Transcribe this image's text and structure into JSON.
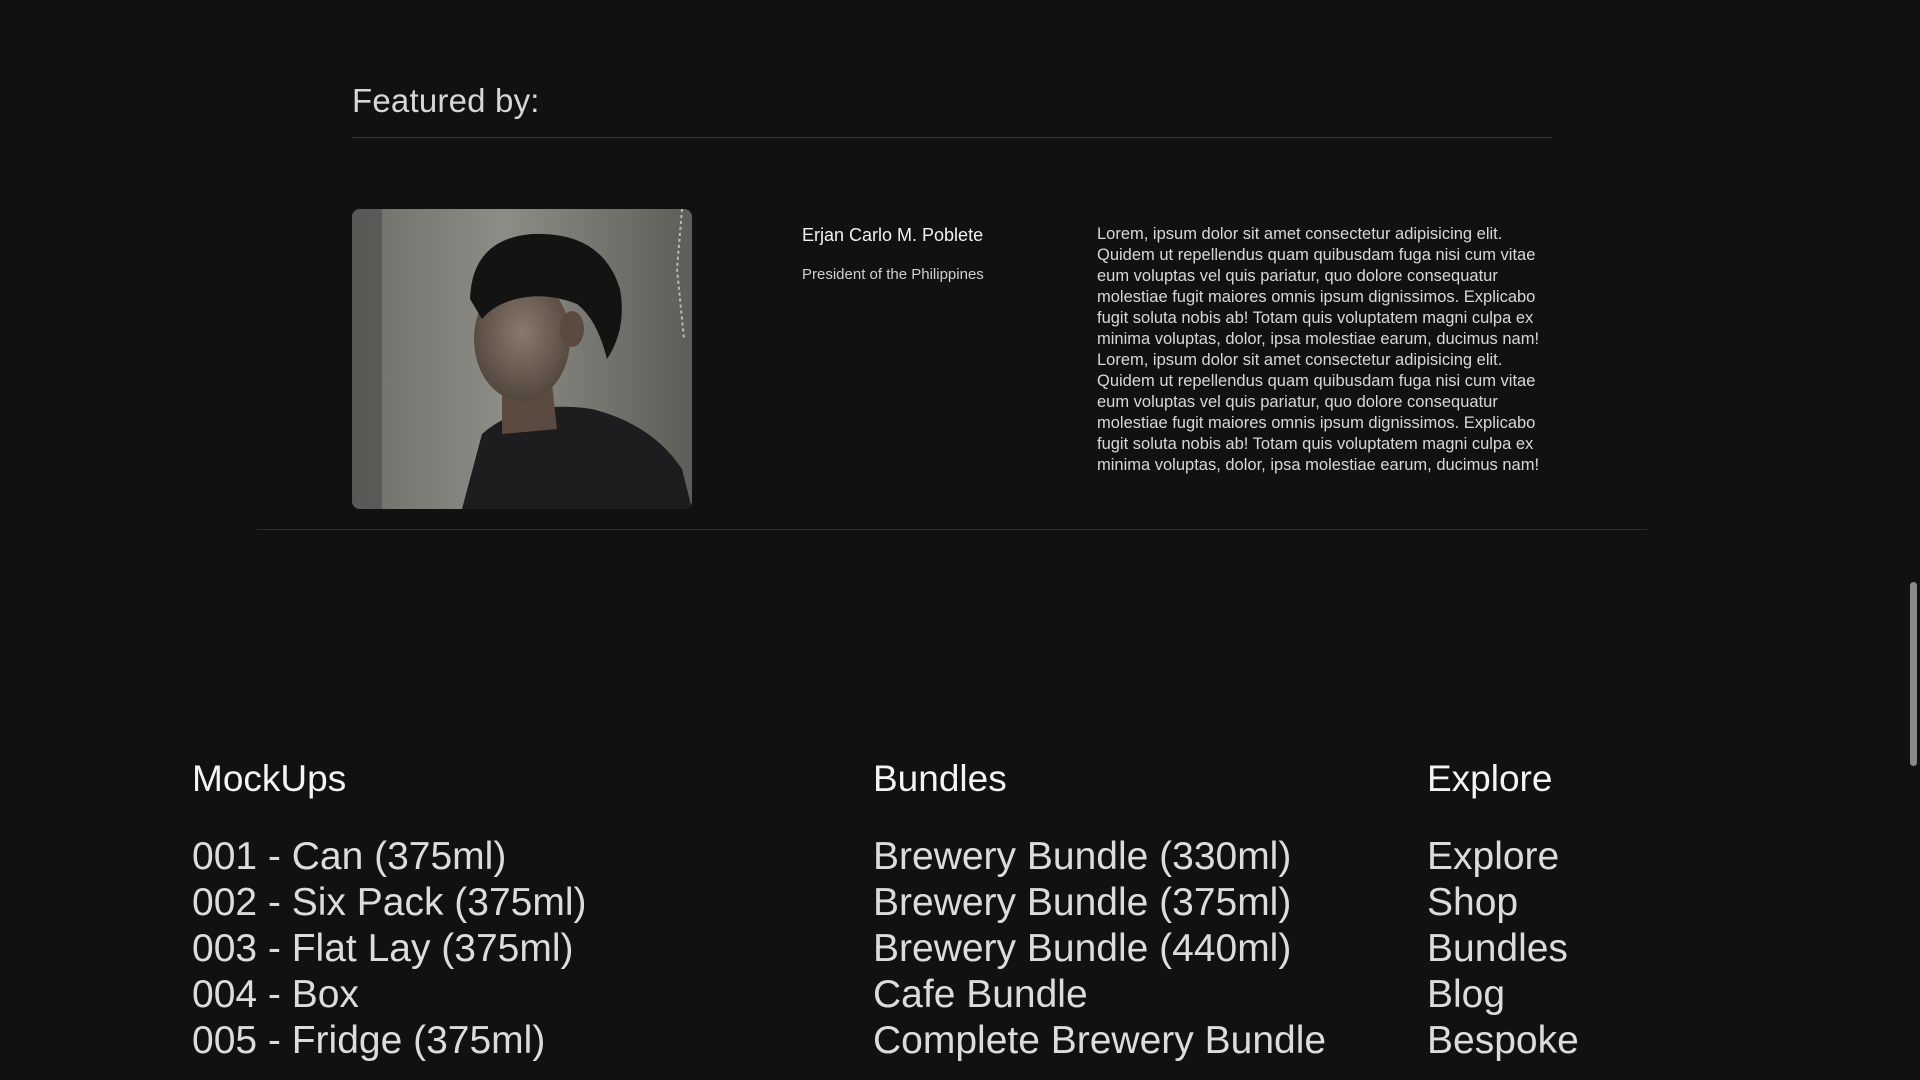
{
  "featured": {
    "heading": "Featured by:",
    "person": {
      "name": "Erjan Carlo M. Poblete",
      "title": "President of the Philippines",
      "bio": "Lorem, ipsum dolor sit amet consectetur adipisicing elit. Quidem ut repellendus quam quibusdam fuga nisi cum vitae eum voluptas vel quis pariatur, quo dolore consequatur molestiae fugit maiores omnis ipsum dignissimos. Explicabo fugit soluta nobis ab! Totam quis voluptatem magni culpa ex minima voluptas, dolor, ipsa molestiae earum, ducimus nam! Lorem, ipsum dolor sit amet consectetur adipisicing elit. Quidem ut repellendus quam quibusdam fuga nisi cum vitae eum voluptas vel quis pariatur, quo dolore consequatur molestiae fugit maiores omnis ipsum dignissimos. Explicabo fugit soluta nobis ab! Totam quis voluptatem magni culpa ex minima voluptas, dolor, ipsa molestiae earum, ducimus nam!"
    }
  },
  "footer": {
    "mockups": {
      "heading": "MockUps",
      "items": [
        "001 - Can (375ml)",
        "002 - Six Pack (375ml)",
        "003 - Flat Lay (375ml)",
        "004 - Box",
        "005 - Fridge (375ml)"
      ]
    },
    "bundles": {
      "heading": "Bundles",
      "items": [
        "Brewery Bundle (330ml)",
        "Brewery Bundle (375ml)",
        "Brewery Bundle (440ml)",
        "Cafe Bundle",
        "Complete Brewery Bundle"
      ]
    },
    "explore": {
      "heading": "Explore",
      "items": [
        "Explore",
        "Shop",
        "Bundles",
        "Blog",
        "Bespoke"
      ]
    }
  },
  "colors": {
    "background": "#111111",
    "text": "#dcdcdc"
  }
}
